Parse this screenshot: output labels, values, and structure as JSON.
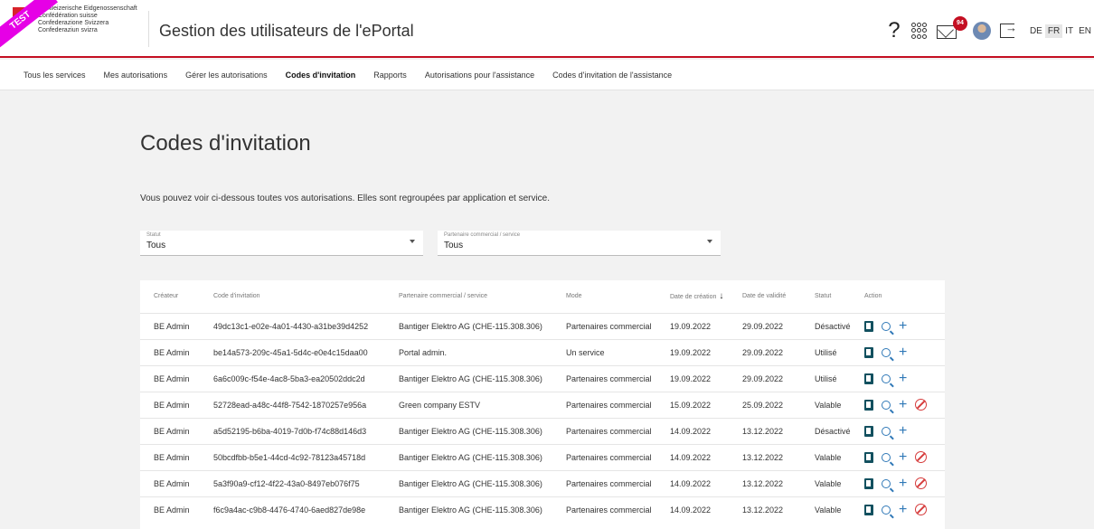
{
  "ribbon": "TEST",
  "logo": {
    "lines": [
      "Schweizerische Eidgenossenschaft",
      "Confédération suisse",
      "Confederazione Svizzera",
      "Confederaziun svizra"
    ]
  },
  "app_title": "Gestion des utilisateurs de l'ePortal",
  "header": {
    "help": "?",
    "mail_badge": "94",
    "languages": [
      "DE",
      "FR",
      "IT",
      "EN"
    ],
    "active_language": "FR"
  },
  "tabs": [
    {
      "label": "Tous les services",
      "active": false
    },
    {
      "label": "Mes autorisations",
      "active": false
    },
    {
      "label": "Gérer les autorisations",
      "active": false
    },
    {
      "label": "Codes d'invitation",
      "active": true
    },
    {
      "label": "Rapports",
      "active": false
    },
    {
      "label": "Autorisations pour l'assistance",
      "active": false
    },
    {
      "label": "Codes d'invitation de l'assistance",
      "active": false
    }
  ],
  "page_title": "Codes d'invitation",
  "description": "Vous pouvez voir ci-dessous toutes vos autorisations. Elles sont regroupées par application et service.",
  "filters": {
    "status": {
      "label": "Statut",
      "value": "Tous"
    },
    "partner": {
      "label": "Partenaire commercial / service",
      "value": "Tous"
    }
  },
  "table": {
    "headers": [
      "Créateur",
      "Code d'invitation",
      "Partenaire commercial / service",
      "Mode",
      "Date de création",
      "Date de validité",
      "Statut",
      "Action"
    ],
    "rows": [
      {
        "creator": "BE Admin",
        "code": "49dc13c1-e02e-4a01-4430-a31be39d4252",
        "partner": "Bantiger Elektro AG (CHE-115.308.306)",
        "mode": "Partenaires commercial",
        "created": "19.09.2022",
        "valid": "29.09.2022",
        "status": "Désactivé",
        "revocable": false
      },
      {
        "creator": "BE Admin",
        "code": "be14a573-209c-45a1-5d4c-e0e4c15daa00",
        "partner": "Portal admin.",
        "mode": "Un service",
        "created": "19.09.2022",
        "valid": "29.09.2022",
        "status": "Utilisé",
        "revocable": false
      },
      {
        "creator": "BE Admin",
        "code": "6a6c009c-f54e-4ac8-5ba3-ea20502ddc2d",
        "partner": "Bantiger Elektro AG (CHE-115.308.306)",
        "mode": "Partenaires commercial",
        "created": "19.09.2022",
        "valid": "29.09.2022",
        "status": "Utilisé",
        "revocable": false
      },
      {
        "creator": "BE Admin",
        "code": "52728ead-a48c-44f8-7542-1870257e956a",
        "partner": "Green company ESTV",
        "mode": "Partenaires commercial",
        "created": "15.09.2022",
        "valid": "25.09.2022",
        "status": "Valable",
        "revocable": true
      },
      {
        "creator": "BE Admin",
        "code": "a5d52195-b6ba-4019-7d0b-f74c88d146d3",
        "partner": "Bantiger Elektro AG (CHE-115.308.306)",
        "mode": "Partenaires commercial",
        "created": "14.09.2022",
        "valid": "13.12.2022",
        "status": "Désactivé",
        "revocable": false
      },
      {
        "creator": "BE Admin",
        "code": "50bcdfbb-b5e1-44cd-4c92-78123a45718d",
        "partner": "Bantiger Elektro AG (CHE-115.308.306)",
        "mode": "Partenaires commercial",
        "created": "14.09.2022",
        "valid": "13.12.2022",
        "status": "Valable",
        "revocable": true
      },
      {
        "creator": "BE Admin",
        "code": "5a3f90a9-cf12-4f22-43a0-8497eb076f75",
        "partner": "Bantiger Elektro AG (CHE-115.308.306)",
        "mode": "Partenaires commercial",
        "created": "14.09.2022",
        "valid": "13.12.2022",
        "status": "Valable",
        "revocable": true
      },
      {
        "creator": "BE Admin",
        "code": "f6c9a4ac-c9b8-4476-4740-6aed827de98e",
        "partner": "Bantiger Elektro AG (CHE-115.308.306)",
        "mode": "Partenaires commercial",
        "created": "14.09.2022",
        "valid": "13.12.2022",
        "status": "Valable",
        "revocable": true
      }
    ]
  },
  "colors": {
    "accent_red": "#c40f22",
    "icon_blue": "#2f78b7",
    "icon_teal": "#12505f",
    "revoke_red": "#d63c3c",
    "ribbon": "#e600e6"
  },
  "icons": {
    "help": "help-icon",
    "apps": "apps-grid-icon",
    "mail": "mail-icon",
    "logout": "logout-icon",
    "copy": "clipboard-icon",
    "view": "search-icon",
    "add": "plus-icon",
    "revoke": "block-icon"
  }
}
